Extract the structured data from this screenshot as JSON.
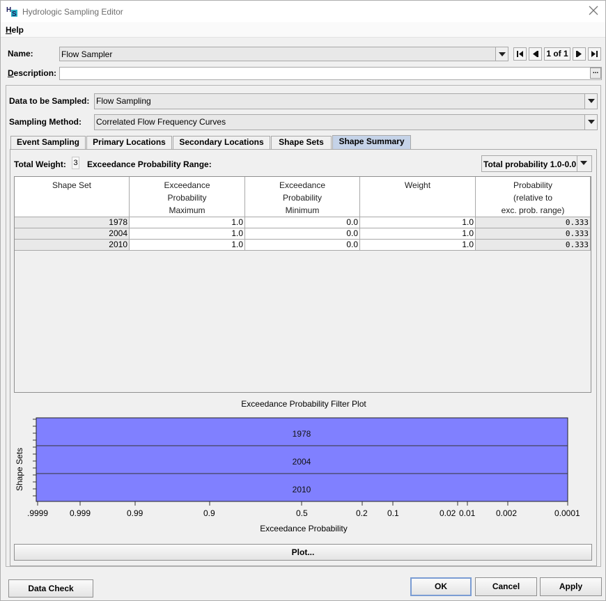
{
  "window": {
    "title": "Hydrologic Sampling Editor",
    "app_icon_letters": "HS"
  },
  "menu": {
    "help": "Help",
    "help_mnemonic": "H",
    "help_rest": "elp"
  },
  "name_field": {
    "label": "Name:",
    "value": "Flow Sampler"
  },
  "record_nav": {
    "count": "1 of 1"
  },
  "description_field": {
    "label": "Description:",
    "label_mnemonic": "D",
    "label_rest": "escription:",
    "value": "",
    "ellipsis": "..."
  },
  "data_sampled": {
    "label": "Data to be Sampled:",
    "value": "Flow Sampling"
  },
  "sampling_method": {
    "label": "Sampling Method:",
    "value": "Correlated Flow Frequency Curves"
  },
  "tabs": [
    {
      "label": "Event Sampling",
      "active": false
    },
    {
      "label": "Primary Locations",
      "active": false
    },
    {
      "label": "Secondary Locations",
      "active": false
    },
    {
      "label": "Shape Sets",
      "active": false
    },
    {
      "label": "Shape Summary",
      "active": true
    }
  ],
  "summary": {
    "total_weight_label": "Total Weight:",
    "total_weight_value": "3",
    "range_label": "Exceedance Probability Range:",
    "range_value": "Total probability 1.0-0.0"
  },
  "table": {
    "headers": [
      [
        "Shape Set"
      ],
      [
        "Exceedance",
        "Probability",
        "Maximum"
      ],
      [
        "Exceedance",
        "Probability",
        "Minimum"
      ],
      [
        "Weight"
      ],
      [
        "Probability",
        "(relative to",
        "exc. prob. range)"
      ]
    ],
    "rows": [
      [
        "1978",
        "1.0",
        "0.0",
        "1.0",
        "0.333"
      ],
      [
        "2004",
        "1.0",
        "0.0",
        "1.0",
        "0.333"
      ],
      [
        "2010",
        "1.0",
        "0.0",
        "1.0",
        "0.333"
      ]
    ]
  },
  "plot": {
    "title": "Exceedance Probability Filter Plot",
    "ylabel": "Shape Sets",
    "xlabel": "Exceedance Probability",
    "bar_color": "#8080ff",
    "bars": [
      "1978",
      "2004",
      "2010"
    ],
    "x_ticks": [
      ".9999",
      "0.999",
      "0.99",
      "0.9",
      "0.5",
      "0.2",
      "0.1",
      "0.02",
      "0.01",
      "0.002",
      "0.0001"
    ],
    "plot_button": "Plot..."
  },
  "buttons": {
    "data_check": "Data Check",
    "ok": "OK",
    "cancel": "Cancel",
    "apply": "Apply"
  }
}
